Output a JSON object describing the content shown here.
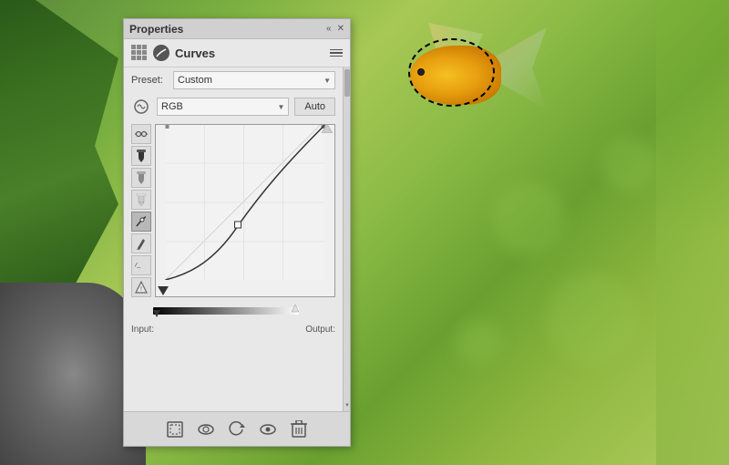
{
  "panel": {
    "title": "Properties",
    "section": "Curves",
    "preset_label": "Preset:",
    "preset_value": "Custom",
    "channel_value": "RGB",
    "auto_label": "Auto",
    "input_label": "Input:",
    "output_label": "Output:",
    "input_value": "",
    "output_value": ""
  },
  "tools": [
    {
      "name": "curves-adjust",
      "icon": "↕",
      "active": false
    },
    {
      "name": "eyedropper-black",
      "icon": "✒",
      "active": false
    },
    {
      "name": "eyedropper-gray",
      "icon": "✒",
      "active": false
    },
    {
      "name": "eyedropper-white",
      "icon": "✒",
      "active": false
    },
    {
      "name": "curve-tool",
      "icon": "∿",
      "active": true
    },
    {
      "name": "pencil-tool",
      "icon": "✏",
      "active": false
    },
    {
      "name": "smooth-tool",
      "icon": "⁻",
      "active": false
    },
    {
      "name": "warning-icon",
      "icon": "⚠",
      "active": false
    }
  ],
  "bottom_toolbar": [
    {
      "name": "clipping-mask",
      "icon": "⊡"
    },
    {
      "name": "visibility",
      "icon": "👁"
    },
    {
      "name": "reset",
      "icon": "↺"
    },
    {
      "name": "view",
      "icon": "👁"
    },
    {
      "name": "delete",
      "icon": "🗑"
    }
  ],
  "colors": {
    "panel_bg": "#e8e8e8",
    "titlebar_bg": "#d0d0d0",
    "graph_bg": "#f0f0f0",
    "accent": "#b8b8b8"
  }
}
